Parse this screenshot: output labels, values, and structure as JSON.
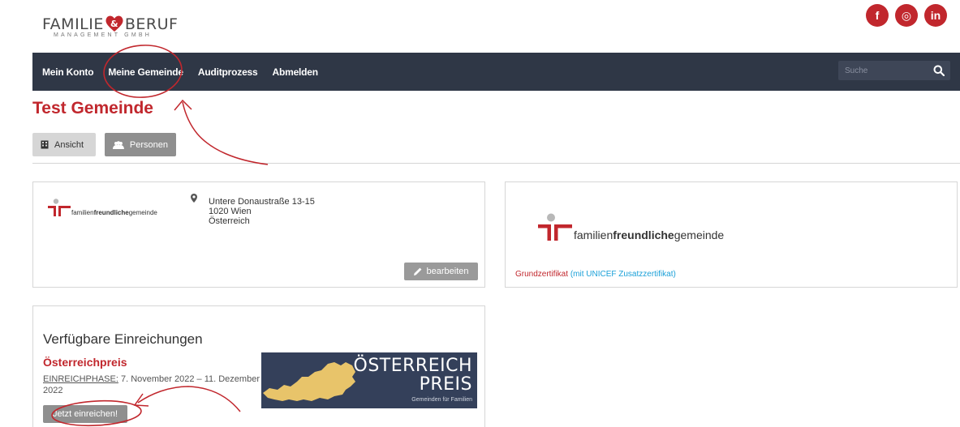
{
  "logo": {
    "text_left": "FAMILIE",
    "text_right": "BERUF",
    "subline": "MANAGEMENT GMBH"
  },
  "social": [
    "f",
    "◎",
    "in"
  ],
  "nav": {
    "items": [
      "Mein Konto",
      "Meine Gemeinde",
      "Auditprozess",
      "Abmelden"
    ],
    "search_placeholder": "Suche"
  },
  "page": {
    "title": "Test Gemeinde",
    "tabs": [
      "Ansicht",
      "Personen"
    ]
  },
  "info_card": {
    "logo_text_a": "familien",
    "logo_text_b": "freundliche",
    "logo_text_c": "gemeinde",
    "address_street": "Untere Donaustraße 13-15",
    "address_city": "1020 Wien",
    "address_country": "Österreich",
    "edit_label": "bearbeiten"
  },
  "cert_card": {
    "logo_text_a": "familien",
    "logo_text_b": "freundliche",
    "logo_text_c": "gemeinde",
    "cert_main": "Grundzertifikat",
    "cert_extra": "(mit UNICEF Zusatzzertifikat)"
  },
  "submissions": {
    "heading": "Verfügbare Einreichungen",
    "award_title": "Österreichpreis",
    "phase_label": "EINREICHPHASE:",
    "phase_value": " 7. November 2022 – 11. Dezember 2022",
    "submit_label": "Jetzt einreichen!",
    "banner_line1": "ÖSTERREICH",
    "banner_line2": "PREIS",
    "banner_line3": "Gemeinden für Familien"
  },
  "colors": {
    "accent_red": "#c1272d",
    "nav_bg": "#2f3746",
    "link_blue": "#1aa0d8",
    "banner_bg": "#34405a",
    "map_gold": "#e8c46a"
  }
}
